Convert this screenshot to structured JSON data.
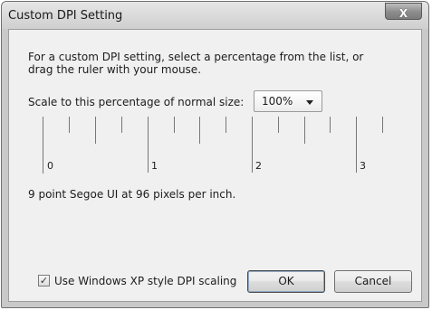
{
  "window": {
    "title": "Custom DPI Setting",
    "close_glyph": "X"
  },
  "description": "For a custom DPI setting, select a percentage from the list, or drag the ruler with your mouse.",
  "scale": {
    "label": "Scale to this percentage of normal size:",
    "value": "100%"
  },
  "ruler": {
    "labels": [
      "0",
      "1",
      "2",
      "3"
    ]
  },
  "info": "9 point Segoe UI at 96 pixels per inch.",
  "xp_scaling": {
    "label": "Use Windows XP style DPI scaling",
    "checked": true,
    "check_glyph": "✓"
  },
  "buttons": {
    "ok": "OK",
    "cancel": "Cancel"
  }
}
